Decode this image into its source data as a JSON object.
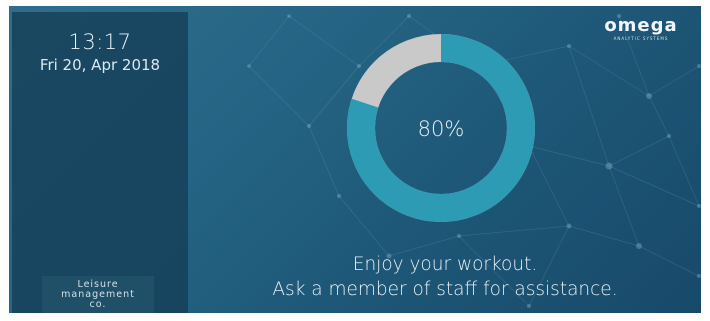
{
  "sidebar": {
    "time": "13:17",
    "date": "Fri 20, Apr 2018",
    "operator_text": "Leisure\nmanagement\nco."
  },
  "brand": {
    "name": "omega",
    "tagline": "ANALYTIC SYSTEMS"
  },
  "progress": {
    "value_percent": 80,
    "label": "80%",
    "fill_color": "#2c9bb3",
    "remaining_color": "#c9c9c9"
  },
  "message": {
    "line1": "Enjoy your workout.",
    "line2": "Ask a member of staff for assistance."
  }
}
